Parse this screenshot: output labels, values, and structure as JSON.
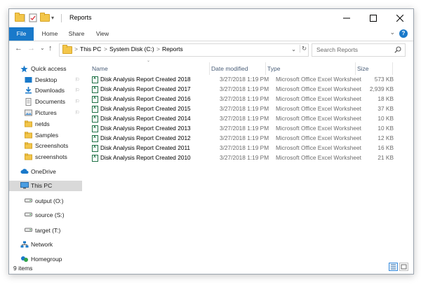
{
  "window": {
    "title": "Reports"
  },
  "ribbon": {
    "tabs": [
      "File",
      "Home",
      "Share",
      "View"
    ],
    "help": "?"
  },
  "nav": {
    "back": "←",
    "forward": "→",
    "up": "↑",
    "recent": "⌄",
    "refresh": "↻",
    "dropdown": "⌄"
  },
  "address": {
    "crumbs": [
      "This PC",
      "System Disk (C:)",
      "Reports"
    ],
    "sep": ">"
  },
  "search": {
    "placeholder": "Search Reports"
  },
  "sidebar": {
    "items": [
      {
        "label": "Quick access",
        "icon": "star-icon",
        "color": "#1979ca"
      },
      {
        "label": "Desktop",
        "icon": "desktop-icon",
        "color": "#1979ca",
        "pinned": true
      },
      {
        "label": "Downloads",
        "icon": "downloads-icon",
        "color": "#1979ca",
        "pinned": true
      },
      {
        "label": "Documents",
        "icon": "documents-icon",
        "color": "#8a8a8a",
        "pinned": true
      },
      {
        "label": "Pictures",
        "icon": "pictures-icon",
        "color": "#8a8a8a",
        "pinned": true
      },
      {
        "label": "netds",
        "icon": "folder-icon",
        "color": "#f3c64a"
      },
      {
        "label": "Samples",
        "icon": "folder-icon",
        "color": "#f3c64a"
      },
      {
        "label": "Screenshots",
        "icon": "folder-icon",
        "color": "#f3c64a"
      },
      {
        "label": "screenshots",
        "icon": "folder-icon",
        "color": "#f3c64a"
      },
      {
        "label": "OneDrive",
        "icon": "cloud-icon",
        "color": "#1979ca"
      },
      {
        "label": "This PC",
        "icon": "computer-icon",
        "color": "#4a9de2",
        "selected": true
      },
      {
        "label": "output (O:)",
        "icon": "drive-icon",
        "color": "#7a7a7a"
      },
      {
        "label": "source (S:)",
        "icon": "drive-icon",
        "color": "#7a7a7a"
      },
      {
        "label": "target (T:)",
        "icon": "drive-icon",
        "color": "#7a7a7a"
      },
      {
        "label": "Network",
        "icon": "network-icon",
        "color": "#1979ca"
      },
      {
        "label": "Homegroup",
        "icon": "homegroup-icon",
        "color": "#1979ca"
      }
    ]
  },
  "columns": {
    "name": "Name",
    "date": "Date modified",
    "type": "Type",
    "size": "Size"
  },
  "files": [
    {
      "name": "Disk Analysis Report Created 2018",
      "date": "3/27/2018 1:19 PM",
      "type": "Microsoft Office Excel Worksheet",
      "size": "573 KB"
    },
    {
      "name": "Disk Analysis Report Created 2017",
      "date": "3/27/2018 1:19 PM",
      "type": "Microsoft Office Excel Worksheet",
      "size": "2,939 KB"
    },
    {
      "name": "Disk Analysis Report Created 2016",
      "date": "3/27/2018 1:19 PM",
      "type": "Microsoft Office Excel Worksheet",
      "size": "18 KB"
    },
    {
      "name": "Disk Analysis Report Created 2015",
      "date": "3/27/2018 1:19 PM",
      "type": "Microsoft Office Excel Worksheet",
      "size": "37 KB"
    },
    {
      "name": "Disk Analysis Report Created 2014",
      "date": "3/27/2018 1:19 PM",
      "type": "Microsoft Office Excel Worksheet",
      "size": "10 KB"
    },
    {
      "name": "Disk Analysis Report Created 2013",
      "date": "3/27/2018 1:19 PM",
      "type": "Microsoft Office Excel Worksheet",
      "size": "10 KB"
    },
    {
      "name": "Disk Analysis Report Created 2012",
      "date": "3/27/2018 1:19 PM",
      "type": "Microsoft Office Excel Worksheet",
      "size": "12 KB"
    },
    {
      "name": "Disk Analysis Report Created 2011",
      "date": "3/27/2018 1:19 PM",
      "type": "Microsoft Office Excel Worksheet",
      "size": "16 KB"
    },
    {
      "name": "Disk Analysis Report Created 2010",
      "date": "3/27/2018 1:19 PM",
      "type": "Microsoft Office Excel Worksheet",
      "size": "21 KB"
    }
  ],
  "status": {
    "count": "9 items"
  },
  "colors": {
    "accent": "#1979ca",
    "header_text": "#4c607a",
    "selection": "#d9d9d9"
  }
}
